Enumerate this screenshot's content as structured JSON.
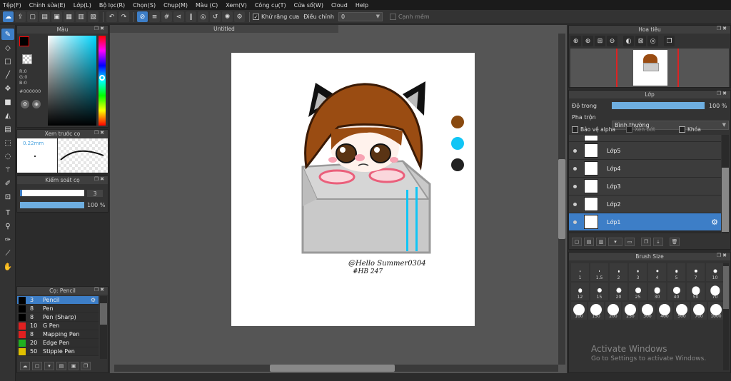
{
  "menu": [
    "Tệp(F)",
    "Chỉnh sửa(E)",
    "Lớp(L)",
    "Bộ lọc(R)",
    "Chọn(S)",
    "Chụp(M)",
    "Màu (C)",
    "Xem(V)",
    "Công cụ(T)",
    "Cửa sổ(W)",
    "Cloud",
    "Help"
  ],
  "toolbar": {
    "antialias_label": "Khử răng cưa",
    "adjust_label": "Điều chỉnh",
    "adjust_value": "0",
    "snap_label": "Cạnh mềm"
  },
  "color_panel": {
    "title": "Màu",
    "r": "R:0",
    "g": "G:0",
    "b": "B:0",
    "hex": "#000000"
  },
  "brush_preview": {
    "title": "Xem trước cọ",
    "size": "0.22mm"
  },
  "brush_control": {
    "title": "Kiểm soát cọ",
    "size_value": "3",
    "opacity_value": "100 %",
    "size_fraction": 0.03,
    "opacity_fraction": 1.0
  },
  "brush_list": {
    "title": "Cọ: Pencil",
    "items": [
      {
        "size": "3",
        "name": "Pencil",
        "color": "#000000"
      },
      {
        "size": "8",
        "name": "Pen",
        "color": "#000000"
      },
      {
        "size": "8",
        "name": "Pen (Sharp)",
        "color": "#000000"
      },
      {
        "size": "10",
        "name": "G Pen",
        "color": "#e02020"
      },
      {
        "size": "8",
        "name": "Mapping Pen",
        "color": "#e02020"
      },
      {
        "size": "20",
        "name": "Edge Pen",
        "color": "#20b020"
      },
      {
        "size": "50",
        "name": "Stipple Pen",
        "color": "#e0c000"
      }
    ]
  },
  "document": {
    "tab_title": "Untitled",
    "signature_line1": "@Hello Summer0304",
    "signature_line2": "#HB 247",
    "swatches": [
      "#8a4a10",
      "#11c5f5",
      "#222222"
    ]
  },
  "navigator": {
    "title": "Hoa tiêu"
  },
  "layers": {
    "title": "Lớp",
    "opacity_label": "Độ trong",
    "opacity_value": "100 %",
    "blend_label": "Pha trộn",
    "blend_value": "Bình thường",
    "protect_alpha": "Bảo vệ alpha",
    "clip": "Xén bớt",
    "lock": "Khóa",
    "items": [
      "Lớp5",
      "Lớp4",
      "Lớp3",
      "Lớp2",
      "Lớp1"
    ]
  },
  "brush_size": {
    "title": "Brush Size",
    "rows": [
      [
        "1",
        "1.5",
        "2",
        "3",
        "4",
        "5",
        "7",
        "10"
      ],
      [
        "12",
        "15",
        "20",
        "25",
        "30",
        "40",
        "50",
        "70"
      ],
      [
        "100",
        "150",
        "200",
        "250",
        "300",
        "400",
        "500",
        "700",
        "1000"
      ]
    ]
  },
  "watermark": {
    "line1": "Activate Windows",
    "line2": "Go to Settings to activate Windows."
  }
}
